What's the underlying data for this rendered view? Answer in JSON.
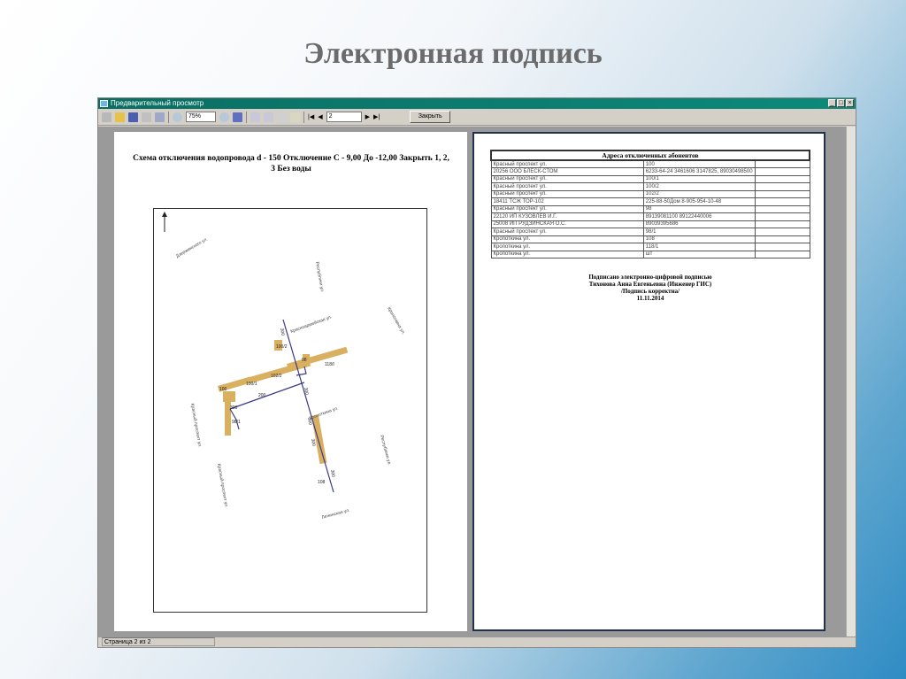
{
  "slide_title": "Электронная подпись",
  "window": {
    "title": "Предварительный просмотр",
    "zoom": "75%",
    "page_input": "2",
    "close_label": "Закрыть",
    "status": "Страница 2 из 2"
  },
  "left_page": {
    "title": "Схема отключения водопровода d - 150  Отключение С - 9,00 До -12,00 Закрыть 1, 2, 3 Без воды",
    "streets": [
      "Дзержинского ул.",
      "Республики ул.",
      "Кропоткина ул.",
      "Красноармейская ул.",
      "Кропоткина ул.",
      "Красный проспект ул.",
      "Красный проспект ул.",
      "Республики ул.",
      "Ленинская ул."
    ],
    "labels": [
      "300",
      "100/2",
      "98",
      "118/I",
      "102/2",
      "100/1",
      "100",
      "200",
      "300",
      "300",
      "300",
      "300",
      "108",
      "300",
      "98/1"
    ]
  },
  "right_page": {
    "table_header": "Адреса отключенных абонентов",
    "rows": [
      [
        "Красный проспект ул.",
        "100",
        ""
      ],
      [
        "20256 ООО БЛЕСК-СТОМ",
        "6233-64-24 3461606 3147825, 89030498500",
        ""
      ],
      [
        "Красный проспект ул.",
        "100/1",
        ""
      ],
      [
        "Красный проспект ул.",
        "100/2",
        ""
      ],
      [
        "Красный проспект ул.",
        "102/2",
        ""
      ],
      [
        "18411 ТСЖ ТОР-102",
        "225-88-50Дом 8-905-954-10-48",
        ""
      ],
      [
        "Красный проспект ул.",
        "98",
        ""
      ],
      [
        "22120 ИП КУЗОВЛЕВ И.Г.",
        "89139081100 89122440006",
        ""
      ],
      [
        "25008 ИП РУДЗИНСКАЯ О.С.",
        "89039395686",
        ""
      ],
      [
        "Красный проспект ул.",
        "98/1",
        ""
      ],
      [
        "Кропоткина ул.",
        "108",
        ""
      ],
      [
        "Кропоткина ул.",
        "118/1",
        ""
      ],
      [
        "Кропоткина ул.",
        "шт",
        ""
      ]
    ],
    "signature": [
      "Подписано электронно-цифровой подписью",
      "Тихонова Анна Евгеньевна (Инженер ГИС)",
      "/Подпись корректна/",
      "11.11.2014"
    ]
  }
}
